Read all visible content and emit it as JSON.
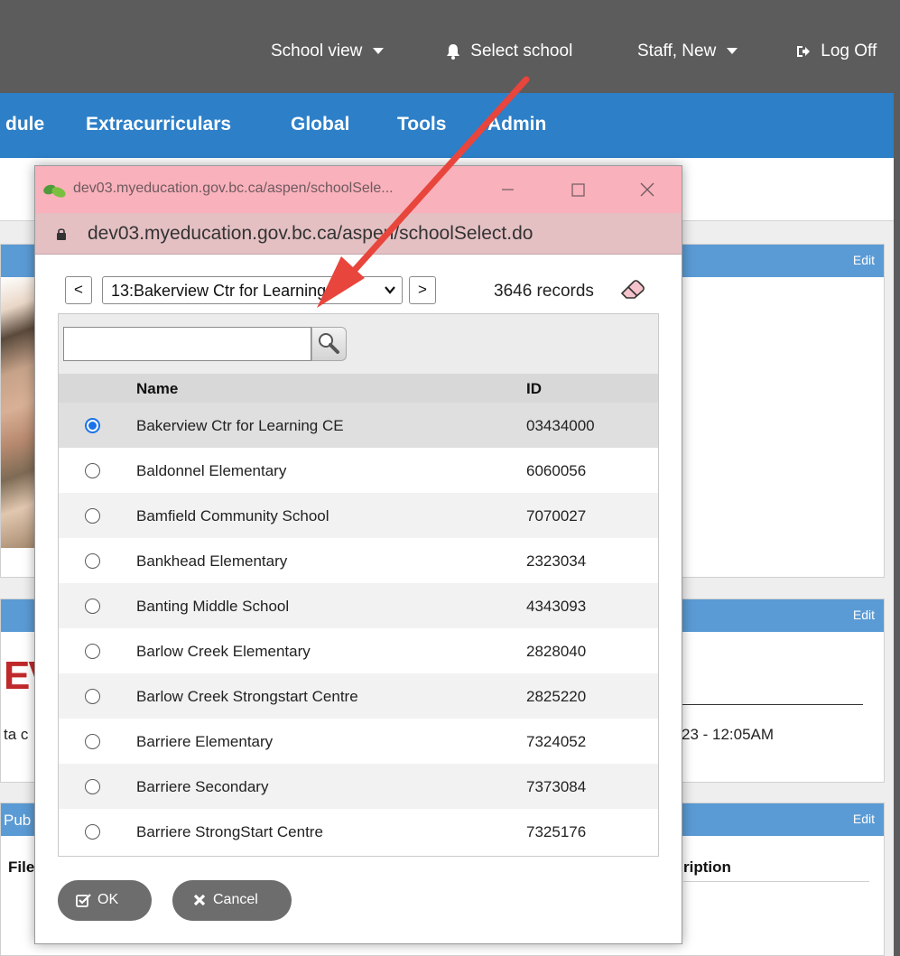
{
  "topbar": {
    "school_view": "School view",
    "select_school": "Select school",
    "user": "Staff, New",
    "log_off": "Log Off"
  },
  "navbar": {
    "items": [
      "dule",
      "Extracurriculars",
      "Global",
      "Tools",
      "Admin"
    ]
  },
  "background": {
    "panel_edit": "Edit",
    "red_text": "EV",
    "left_fragment": "ta c",
    "timestamp_fragment": "23 - 12:05AM",
    "pub_fragment": "Pub",
    "file_fragment": "File",
    "desc_fragment": "ription"
  },
  "popup": {
    "title": "dev03.myeducation.gov.bc.ca/aspen/schoolSele...",
    "address": "dev03.myeducation.gov.bc.ca/aspen/schoolSelect.do",
    "prev_label": "<",
    "next_label": ">",
    "selected_school": "13:Bakerview Ctr for Learning",
    "records": "3646 records",
    "search": {
      "value": "",
      "placeholder": ""
    },
    "columns": {
      "name": "Name",
      "id": "ID"
    },
    "rows": [
      {
        "name": "Bakerview Ctr for Learning CE",
        "id": "03434000"
      },
      {
        "name": "Baldonnel Elementary",
        "id": "6060056"
      },
      {
        "name": "Bamfield Community School",
        "id": "7070027"
      },
      {
        "name": "Bankhead Elementary",
        "id": "2323034"
      },
      {
        "name": "Banting Middle School",
        "id": "4343093"
      },
      {
        "name": "Barlow Creek Elementary",
        "id": "2828040"
      },
      {
        "name": "Barlow Creek Strongstart Centre",
        "id": "2825220"
      },
      {
        "name": "Barriere Elementary",
        "id": "7324052"
      },
      {
        "name": "Barriere Secondary",
        "id": "7373084"
      },
      {
        "name": "Barriere StrongStart Centre",
        "id": "7325176"
      }
    ],
    "selected_row": 0,
    "ok_label": "OK",
    "cancel_label": "Cancel"
  },
  "annotation": {
    "arrow_color": "#e8453c"
  }
}
